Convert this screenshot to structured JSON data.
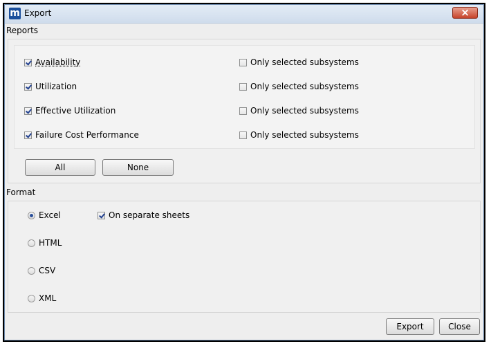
{
  "window": {
    "title": "Export",
    "app_icon": "m"
  },
  "reports": {
    "label": "Reports",
    "items": [
      {
        "label": "Availability",
        "checked": true,
        "subsystem_label": "Only selected subsystems",
        "subsystem_checked": false
      },
      {
        "label": "Utilization",
        "checked": true,
        "subsystem_label": "Only selected subsystems",
        "subsystem_checked": false
      },
      {
        "label": "Effective Utilization",
        "checked": true,
        "subsystem_label": "Only selected subsystems",
        "subsystem_checked": false
      },
      {
        "label": "Failure Cost Performance",
        "checked": true,
        "subsystem_label": "Only selected subsystems",
        "subsystem_checked": false
      }
    ],
    "all_label": "All",
    "none_label": "None"
  },
  "format": {
    "label": "Format",
    "options": [
      {
        "label": "Excel",
        "selected": true
      },
      {
        "label": "HTML",
        "selected": false
      },
      {
        "label": "CSV",
        "selected": false
      },
      {
        "label": "XML",
        "selected": false
      }
    ],
    "separate_sheets_label": "On separate sheets",
    "separate_sheets_checked": true
  },
  "footer": {
    "export_label": "Export",
    "close_label": "Close"
  },
  "colors": {
    "titlebar": "#d6e2f0",
    "close": "#c7432a",
    "check": "#21408f"
  }
}
